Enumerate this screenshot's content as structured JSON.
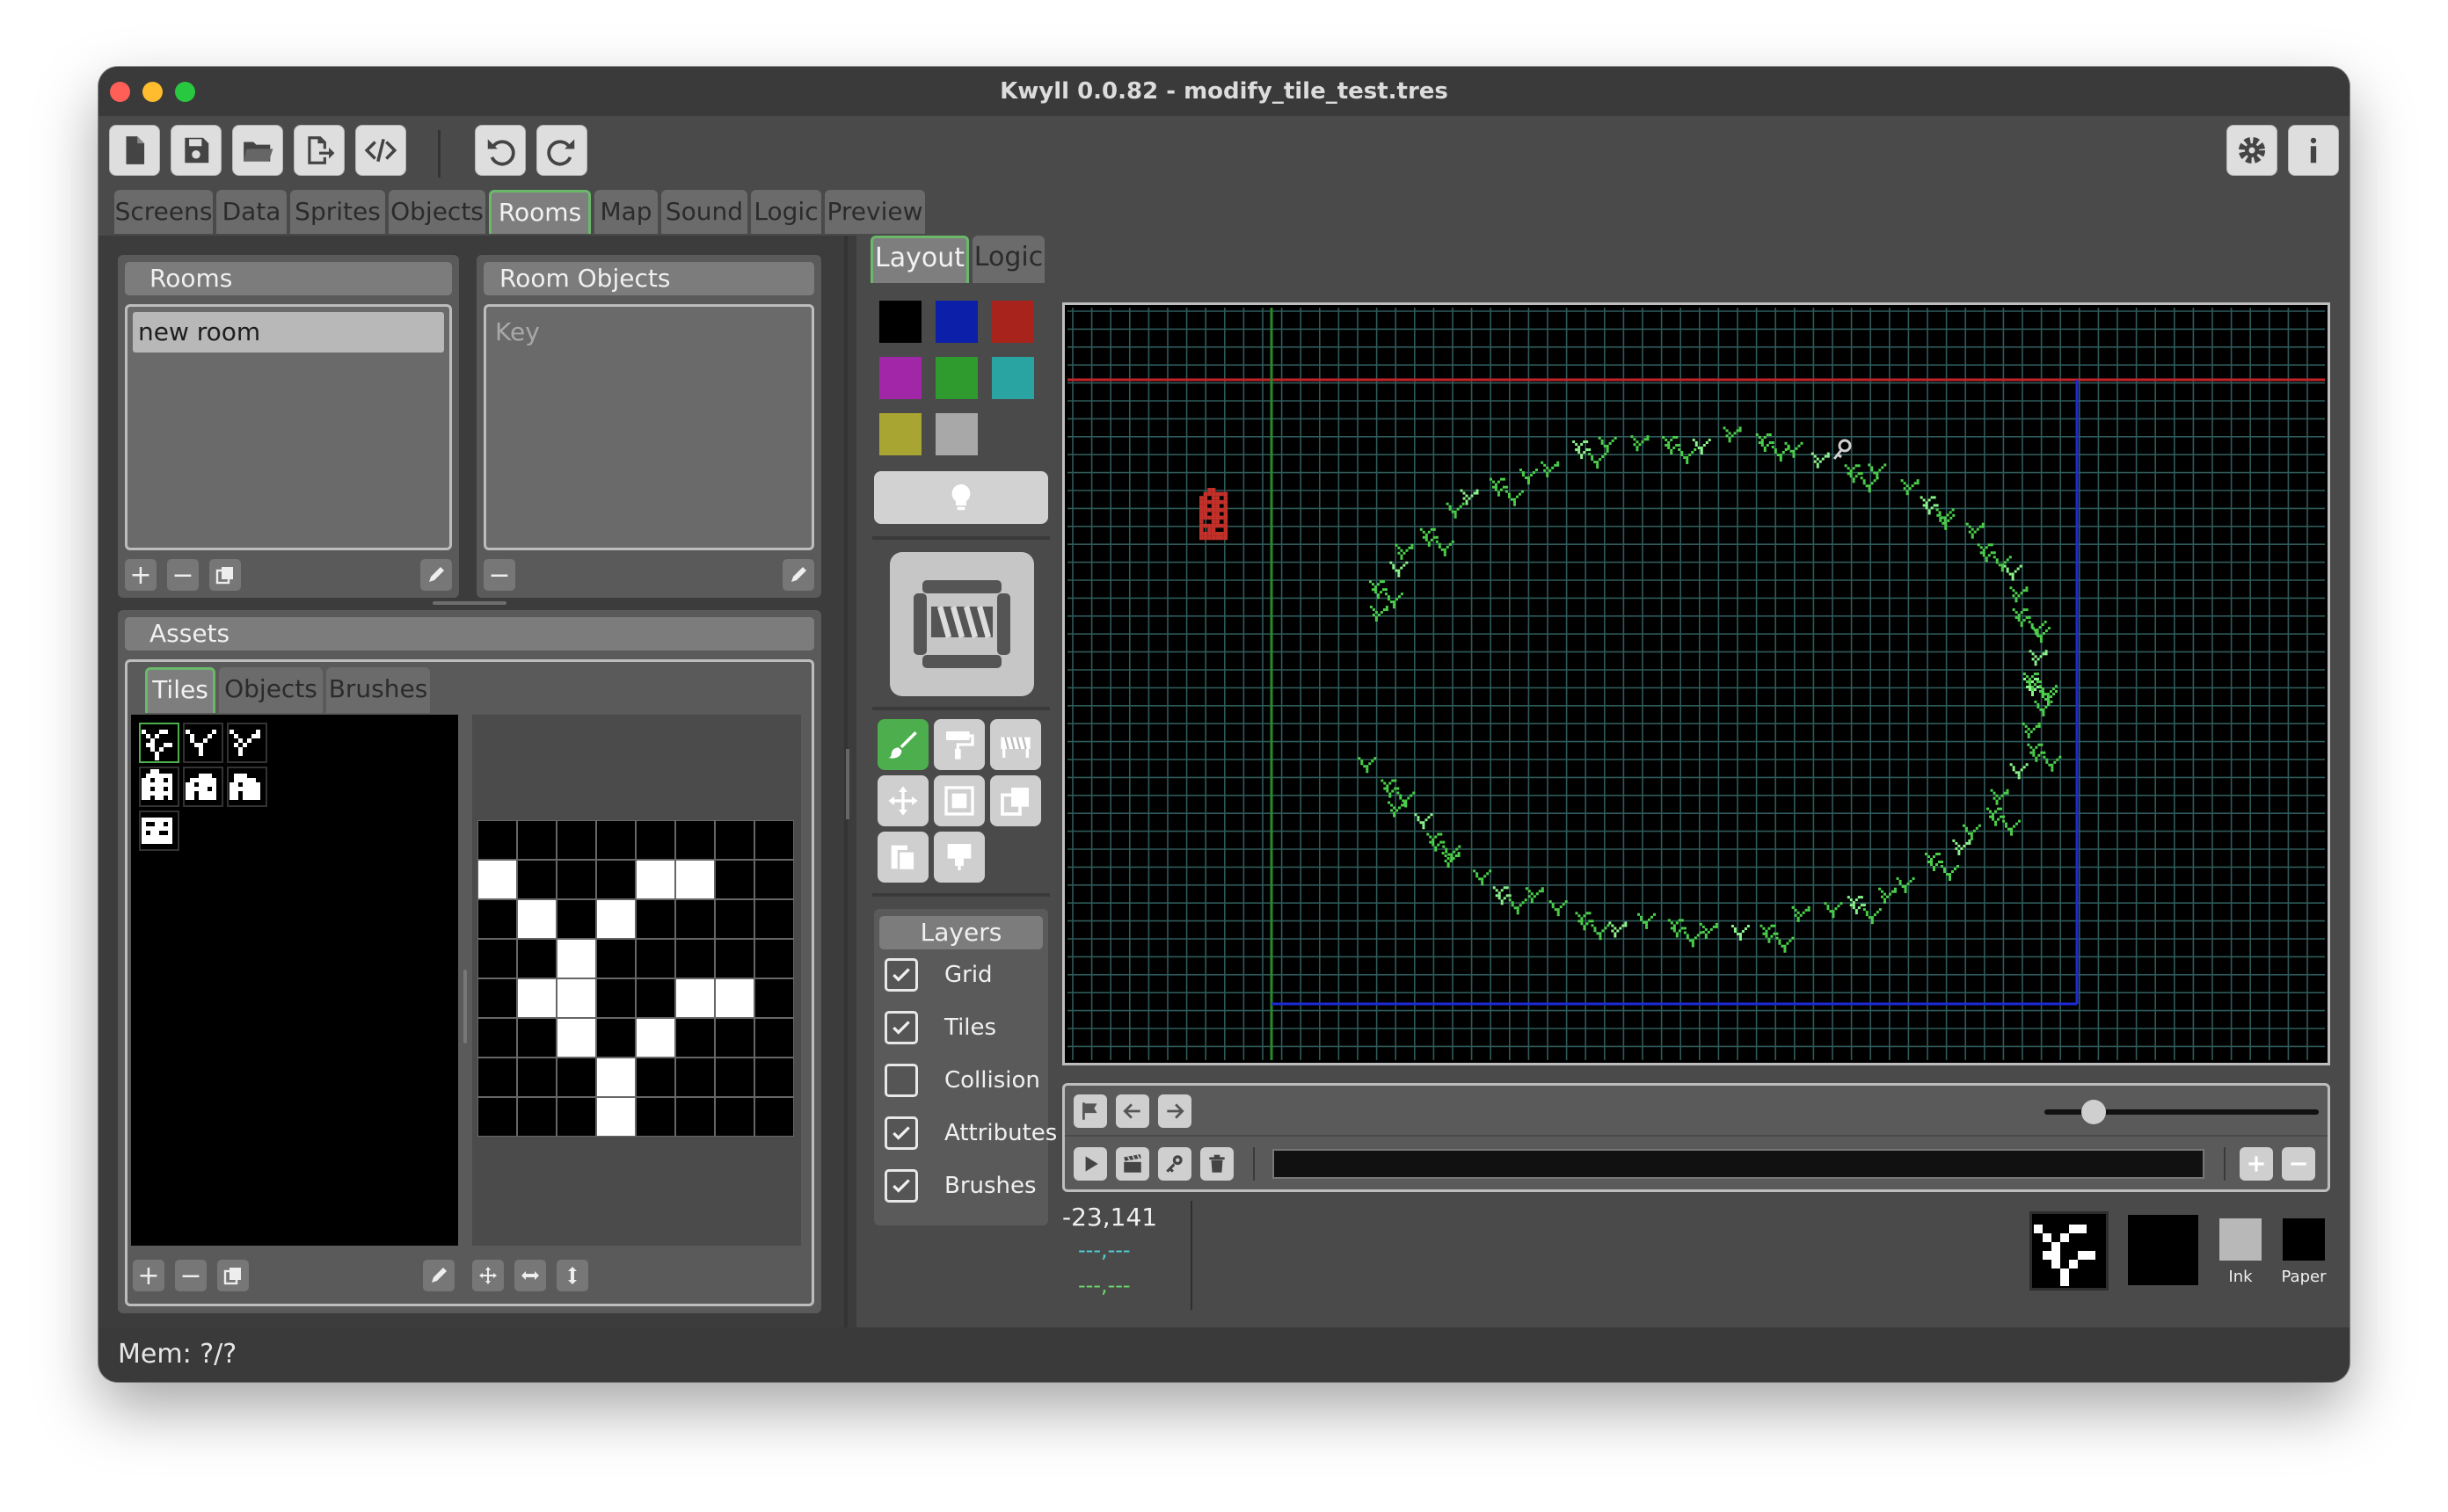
{
  "window": {
    "title": "Kwyll 0.0.82 - modify_tile_test.tres",
    "traffic_colors": [
      "#ff5f57",
      "#febc2e",
      "#28c840"
    ]
  },
  "toolbar": {
    "left_icons": [
      "new-file-icon",
      "save-icon",
      "open-folder-icon",
      "export-icon",
      "code-icon"
    ],
    "history_icons": [
      "undo-icon",
      "redo-icon"
    ],
    "right_icons": [
      "settings-icon",
      "info-icon"
    ]
  },
  "main_tabs": {
    "items": [
      "Screens",
      "Data",
      "Sprites",
      "Objects",
      "Rooms",
      "Map",
      "Sound",
      "Logic",
      "Preview"
    ],
    "active": "Rooms"
  },
  "rooms_panel": {
    "title": "Rooms",
    "items": [
      "new room"
    ],
    "selected": "new room"
  },
  "room_objects_panel": {
    "title": "Room Objects",
    "items": [
      "Key"
    ]
  },
  "assets_panel": {
    "title": "Assets",
    "tabs": [
      "Tiles",
      "Objects",
      "Brushes"
    ],
    "active_tab": "Tiles",
    "tile_count": 7,
    "selected_tile_index": 0
  },
  "tile_editor": {
    "pixels": [
      "00000000",
      "10001100",
      "01010000",
      "00100000",
      "01100110",
      "00101000",
      "00010000",
      "00010000"
    ]
  },
  "editor_tabs": {
    "items": [
      "Layout",
      "Logic"
    ],
    "active": "Layout"
  },
  "palette": {
    "colors": [
      "#000000",
      "#0b1fa8",
      "#a8231b",
      "#a126a8",
      "#2f9b2f",
      "#2aa3a3",
      "#a9a532",
      "#a8a8a8"
    ]
  },
  "tools": {
    "icons": [
      "paint-brush-icon",
      "paint-roller-icon",
      "barrier-icon",
      "move-icon",
      "frame-icon",
      "duplicate-icon",
      "paste-icon",
      "stamp-icon"
    ],
    "active_index": 0
  },
  "layers": {
    "title": "Layers",
    "items": [
      {
        "label": "Grid",
        "checked": true
      },
      {
        "label": "Tiles",
        "checked": true
      },
      {
        "label": "Collision",
        "checked": false
      },
      {
        "label": "Attributes",
        "checked": true
      },
      {
        "label": "Brushes",
        "checked": true
      }
    ]
  },
  "readout": {
    "coords": "-23,141",
    "line2": "---,---",
    "line3": "---,---"
  },
  "colors_preview": {
    "ink_label": "Ink",
    "paper_label": "Paper"
  },
  "zoom_slider": {
    "value": 0.18
  },
  "status": {
    "text": "Mem: ?/?"
  }
}
